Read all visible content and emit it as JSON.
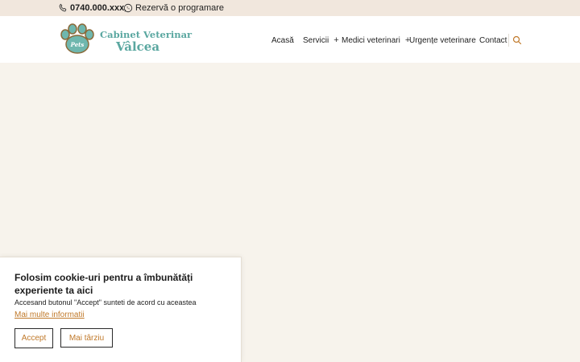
{
  "topbar": {
    "phone": "0740.000.xxx",
    "booking": "Rezervă o programare"
  },
  "logo": {
    "line1": "Cabinet Veterinar",
    "line2": "Vâlcea",
    "badge": "Pets"
  },
  "nav": {
    "items": [
      {
        "label": "Acasă"
      },
      {
        "label": "Servicii",
        "submenu": "+"
      },
      {
        "label": "Medici veterinari",
        "submenu": "+"
      },
      {
        "label": "Urgențe veterinare"
      },
      {
        "label": "Contact"
      }
    ]
  },
  "icons": {
    "phone": "phone-icon",
    "whatsapp": "whatsapp-icon",
    "search": "search-icon",
    "logo": "paw-icon"
  },
  "cookie": {
    "title": "Folosim cookie-uri pentru a îmbunătăți experiente ta aici",
    "description": "Accesand butonul \"Accept\" sunteti de acord cu aceastea",
    "more_link": "Mai multe informatii",
    "accept_label": "Accept",
    "later_label": "Mai târziu"
  },
  "colors": {
    "accent": "#c0792a",
    "brand": "#5aa7a0",
    "topbar_bg": "#f1e7dd",
    "page_bg": "#f7f3ec"
  }
}
